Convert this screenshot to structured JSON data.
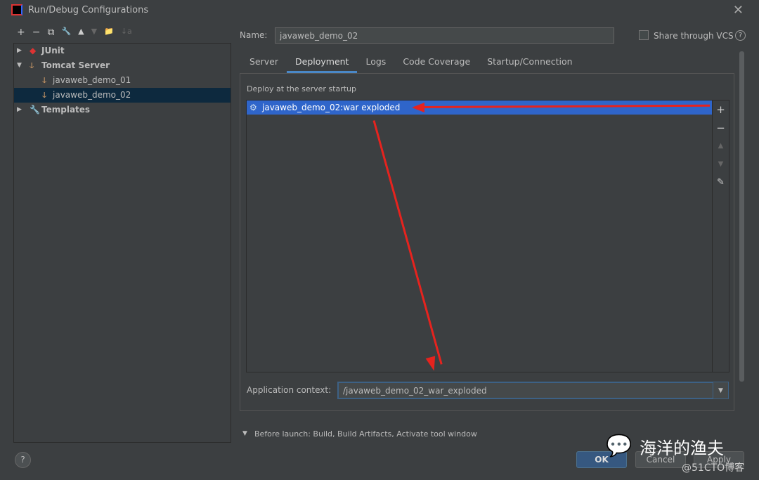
{
  "window": {
    "title": "Run/Debug Configurations"
  },
  "toolbar": {
    "add": "+",
    "remove": "−",
    "copy": "⧉",
    "edit": "🔧",
    "up": "▲",
    "down": "▼",
    "folder": "📁",
    "sort": "↓a"
  },
  "tree": [
    {
      "label": "JUnit",
      "bold": true,
      "icon": "junit-icon"
    },
    {
      "label": "Tomcat Server",
      "bold": true,
      "icon": "tomcat-icon"
    },
    {
      "label": "javaweb_demo_01",
      "icon": "tomcat-icon"
    },
    {
      "label": "javaweb_demo_02",
      "icon": "tomcat-icon",
      "selected": true
    },
    {
      "label": "Templates",
      "bold": true,
      "icon": "wrench-icon"
    }
  ],
  "form": {
    "name_label": "Name:",
    "name_value": "javaweb_demo_02",
    "share_label": "Share through VCS",
    "help": "?"
  },
  "tabs": [
    "Server",
    "Deployment",
    "Logs",
    "Code Coverage",
    "Startup/Connection"
  ],
  "deployment": {
    "section": "Deploy at the server startup",
    "items": [
      "javaweb_demo_02:war exploded"
    ],
    "context_label": "Application context:",
    "context_value": "/javaweb_demo_02_war_exploded"
  },
  "before_launch": "Before launch: Build, Build Artifacts, Activate tool window",
  "buttons": {
    "ok": "OK",
    "cancel": "Cancel",
    "apply": "Apply",
    "help": "?"
  },
  "watermark": {
    "name": "海洋的渔夫",
    "site": "@51CTO博客"
  },
  "colors": {
    "selection": "#2f65ca",
    "accent": "#4a88c7",
    "arrow": "#e6231e"
  }
}
